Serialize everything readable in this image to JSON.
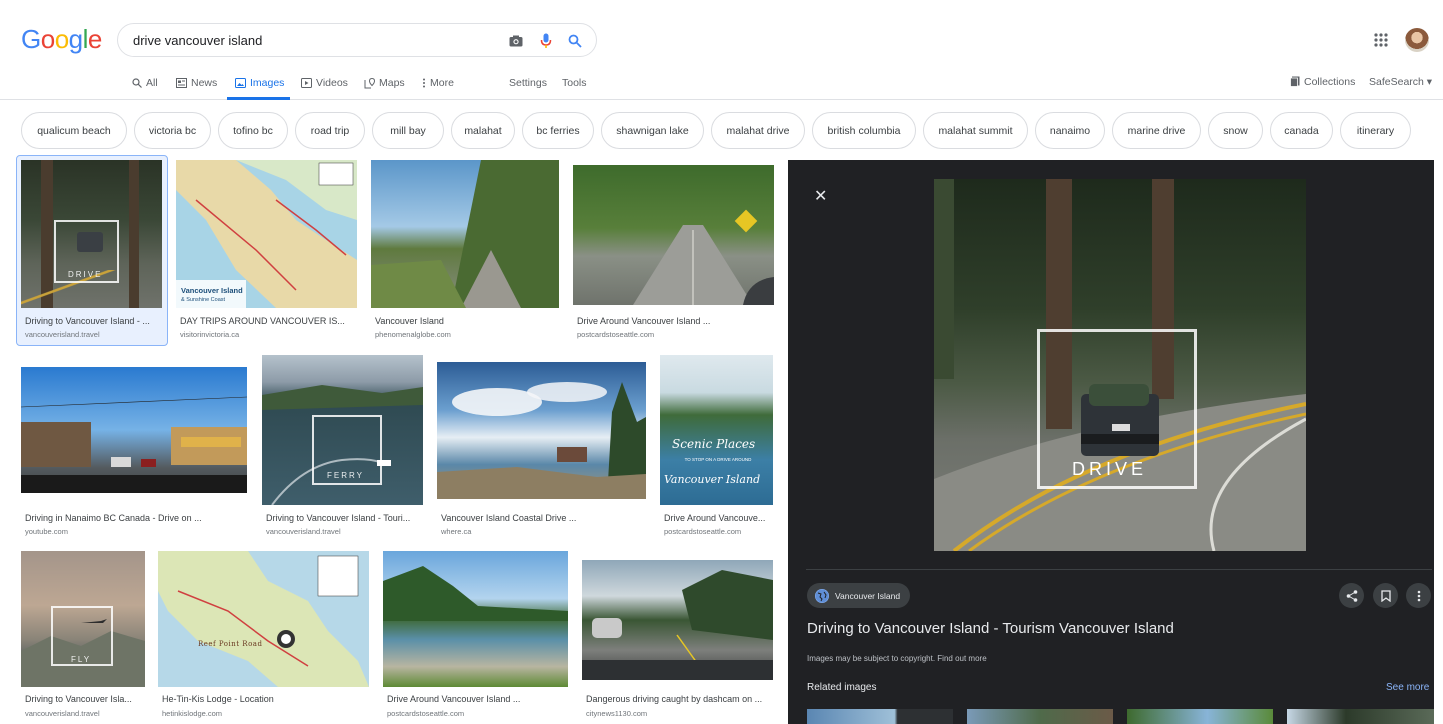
{
  "header": {
    "logo_letters": [
      {
        "ch": "G",
        "color": "#4285F4"
      },
      {
        "ch": "o",
        "color": "#EA4335"
      },
      {
        "ch": "o",
        "color": "#FBBC05"
      },
      {
        "ch": "g",
        "color": "#4285F4"
      },
      {
        "ch": "l",
        "color": "#34A853"
      },
      {
        "ch": "e",
        "color": "#EA4335"
      }
    ],
    "query": "drive vancouver island",
    "tabs": {
      "all": "All",
      "news": "News",
      "images": "Images",
      "videos": "Videos",
      "maps": "Maps",
      "more": "More",
      "settings": "Settings",
      "tools": "Tools"
    },
    "collections": "Collections",
    "safesearch": "SafeSearch ▾"
  },
  "chips": [
    "qualicum beach",
    "victoria bc",
    "tofino bc",
    "road trip",
    "mill bay",
    "malahat",
    "bc ferries",
    "shawnigan lake",
    "malahat drive",
    "british columbia",
    "malahat summit",
    "nanaimo",
    "marine drive",
    "snow",
    "canada",
    "itinerary"
  ],
  "results": [
    {
      "title": "Driving to Vancouver Island - ...",
      "source": "vancouverisland.travel",
      "overlay": "DRIVE"
    },
    {
      "title": "DAY TRIPS AROUND VANCOUVER IS...",
      "source": "visitorinvictoria.ca",
      "map_label": "Vancouver Island",
      "map_sub": "& Sunshine Coast"
    },
    {
      "title": "Vancouver Island",
      "source": "phenomenalglobe.com"
    },
    {
      "title": "Drive Around Vancouver Island ...",
      "source": "postcardstoseattle.com"
    },
    {
      "title": "Driving in Nanaimo BC Canada - Drive on ...",
      "source": "youtube.com"
    },
    {
      "title": "Driving to Vancouver Island - Touri...",
      "source": "vancouverisland.travel",
      "overlay": "FERRY"
    },
    {
      "title": "Vancouver Island Coastal Drive ...",
      "source": "where.ca"
    },
    {
      "title": "Drive Around Vancouve...",
      "source": "postcardstoseattle.com",
      "script1": "Scenic Places",
      "script2": "TO STOP ON A DRIVE AROUND",
      "script3": "Vancouver Island"
    },
    {
      "title": "Driving to Vancouver Isla...",
      "source": "vancouverisland.travel",
      "overlay": "FLY"
    },
    {
      "title": "He-Tin-Kis Lodge - Location",
      "source": "hetinkislodge.com",
      "map_label": "Reef Point Road"
    },
    {
      "title": "Drive Around Vancouver Island ...",
      "source": "postcardstoseattle.com"
    },
    {
      "title": "Dangerous driving caught by dashcam on ...",
      "source": "citynews1130.com"
    }
  ],
  "panel": {
    "close": "✕",
    "overlay": "DRIVE",
    "source": "Vancouver Island",
    "title": "Driving to Vancouver Island - Tourism Vancouver Island",
    "copyright": "Images may be subject to copyright.",
    "find_out": "Find out more",
    "related": "Related images",
    "see_more": "See more"
  }
}
